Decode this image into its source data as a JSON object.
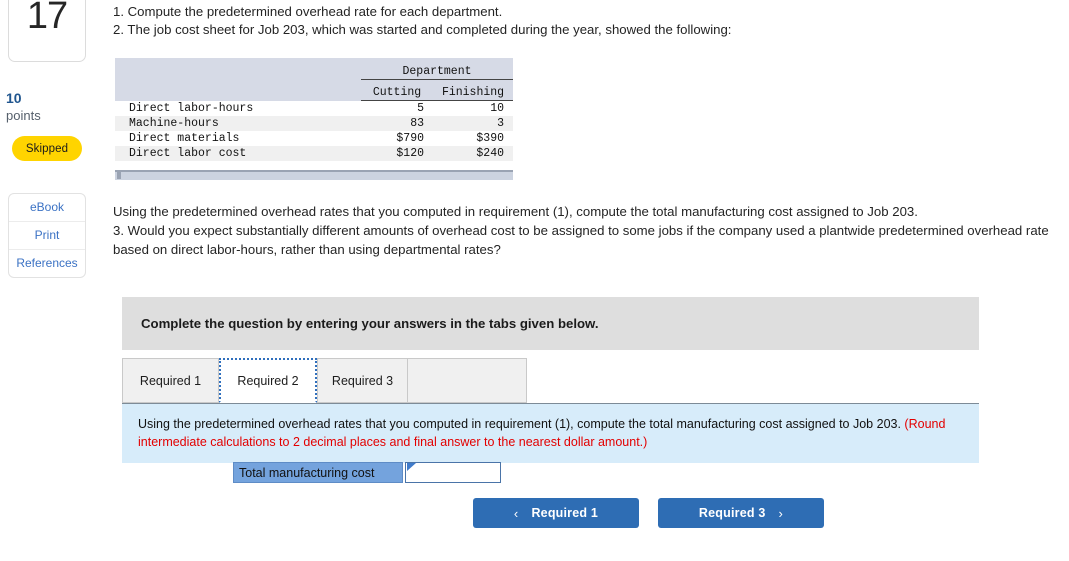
{
  "rail": {
    "question_number": "17",
    "points_value": "10",
    "points_label": "points",
    "status_badge": "Skipped",
    "tools": [
      {
        "label": "eBook"
      },
      {
        "label": "Print"
      },
      {
        "label": "References"
      }
    ]
  },
  "prompt": {
    "line1": "1. Compute the predetermined overhead rate for each department.",
    "line2": "2. The job cost sheet for Job 203, which was started and completed during the year, showed the following:",
    "mid_paragraph_1": "Using the predetermined overhead rates that you computed in requirement (1), compute the total manufacturing cost assigned to Job 203.",
    "mid_paragraph_2": "3. Would you expect substantially different amounts of overhead cost to be assigned to some jobs if the company used a plantwide predetermined overhead rate based on direct labor-hours, rather than using departmental rates?"
  },
  "job_table": {
    "group_header": "Department",
    "columns": [
      "Cutting",
      "Finishing"
    ],
    "rows": [
      {
        "label": "Direct labor-hours",
        "cutting": "5",
        "finishing": "10"
      },
      {
        "label": "Machine-hours",
        "cutting": "83",
        "finishing": "3"
      },
      {
        "label": "Direct materials",
        "cutting": "$790",
        "finishing": "$390"
      },
      {
        "label": "Direct labor cost",
        "cutting": "$120",
        "finishing": "$240"
      }
    ]
  },
  "answer_card": {
    "header": "Complete the question by entering your answers in the tabs given below.",
    "tabs": [
      {
        "label": "Required 1",
        "active": false
      },
      {
        "label": "Required 2",
        "active": true
      },
      {
        "label": "Required 3",
        "active": false
      }
    ],
    "instruction_main": "Using the predetermined overhead rates that you computed in requirement (1), compute the total manufacturing cost assigned to Job 203. ",
    "instruction_note": "(Round intermediate calculations to 2 decimal places and final answer to the nearest dollar amount.)",
    "answer_label": "Total manufacturing cost",
    "answer_value": "",
    "answer_placeholder": ""
  },
  "nav": {
    "prev_label": "Required 1",
    "prev_chevron": "‹",
    "next_label": "Required 3",
    "next_chevron": "›"
  },
  "colors": {
    "button_blue": "#2e6db4",
    "badge_yellow": "#ffd400",
    "instruction_blue": "#d7ecfa",
    "note_red": "#e30000",
    "table_header": "#d6dae6",
    "answer_label_blue": "#74a3dd",
    "link_blue": "#3b72c4"
  }
}
